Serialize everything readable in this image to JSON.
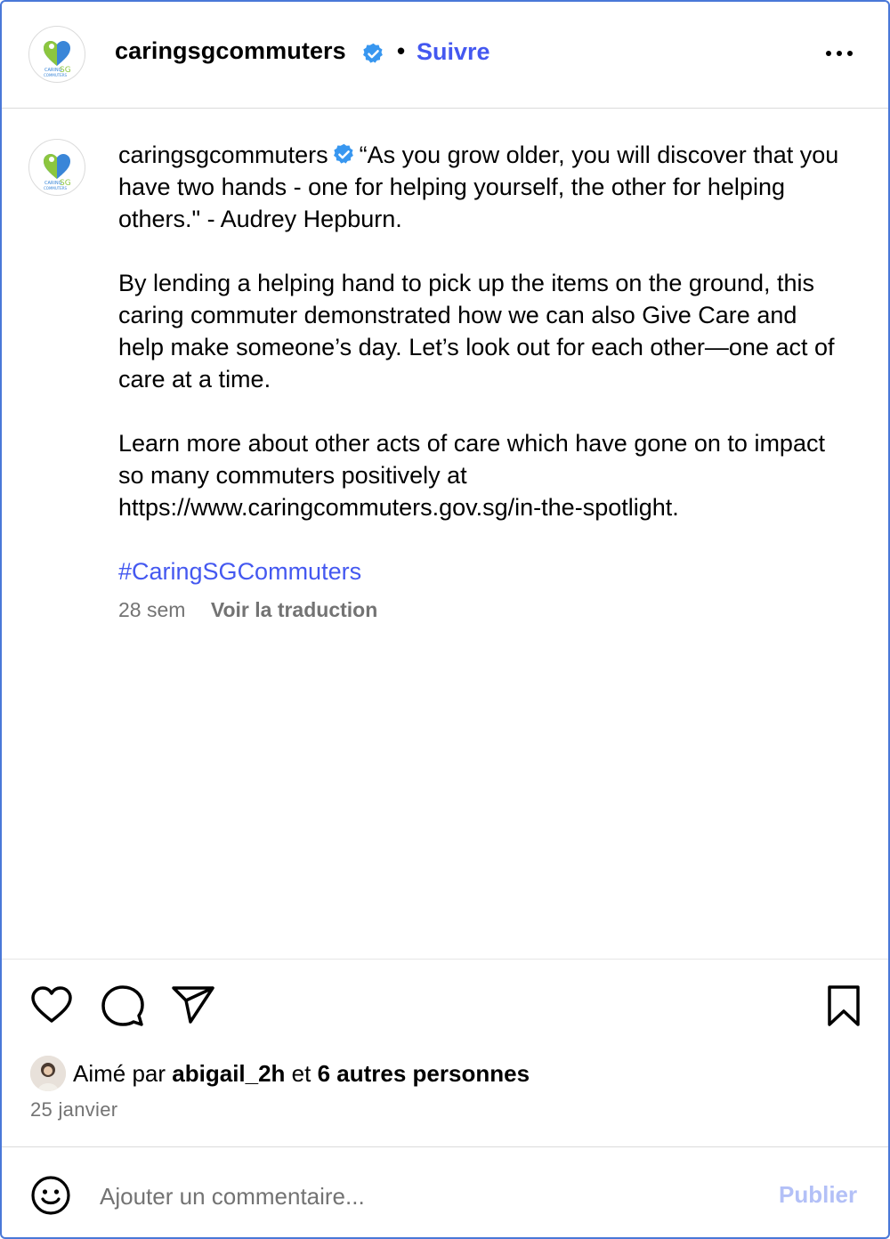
{
  "header": {
    "username": "caringsgcommuters",
    "separator": "•",
    "follow_label": "Suivre",
    "avatar_icon": "caring-sg-commuters-logo-icon",
    "logo_text_line1": "CARING",
    "logo_text_sg": "SG",
    "logo_text_line2": "COMMUTERS",
    "verified_icon": "verified-badge-icon",
    "more_icon": "more-options-icon"
  },
  "caption": {
    "username": "caringsgcommuters",
    "paragraph1": "“As you grow older, you will discover that you have two hands - one for helping yourself, the other for helping others.\" - Audrey Hepburn.",
    "paragraph2": "By lending a helping hand to pick up the items on the ground, this caring commuter demonstrated how we can also Give Care and help make someone’s day. Let’s look out for each other—one act of care at a time.",
    "paragraph3": "Learn more about other acts of care which have gone on to impact so many commuters positively at https://www.caringcommuters.gov.sg/in-the-spotlight.",
    "hashtag": "#CaringSGCommuters",
    "time_ago": "28 sem",
    "translate_label": "Voir la traduction"
  },
  "actions": {
    "like_icon": "heart-icon",
    "comment_icon": "comment-icon",
    "share_icon": "share-icon",
    "save_icon": "bookmark-icon"
  },
  "likes": {
    "prefix": "Aimé par",
    "user": "abigail_2h",
    "joiner": "et",
    "others": "6 autres personnes"
  },
  "date": "25 janvier",
  "comment_box": {
    "emoji_icon": "emoji-icon",
    "placeholder": "Ajouter un commentaire...",
    "publish_label": "Publier"
  },
  "colors": {
    "accent": "#4458f0",
    "verified": "#3897f0",
    "muted": "#737373",
    "publish_disabled": "#b3c0f7",
    "frame": "#4a78d8"
  }
}
